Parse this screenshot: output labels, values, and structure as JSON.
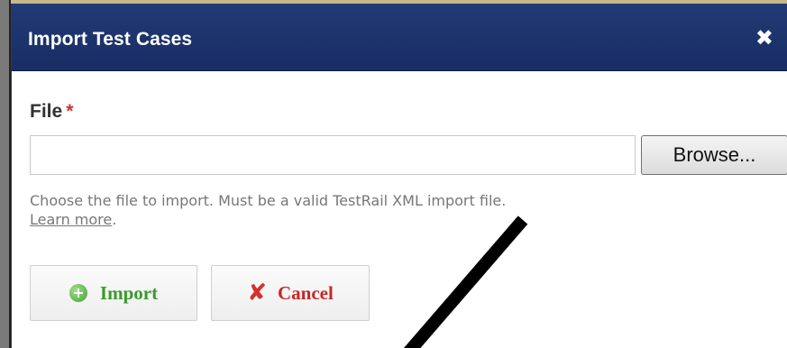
{
  "dialog": {
    "title": "Import Test Cases",
    "close_glyph": "✖"
  },
  "file_field": {
    "label": "File",
    "required_mark": "*",
    "value": "",
    "browse_label": "Browse..."
  },
  "hint": {
    "text": "Choose the file to import. Must be a valid TestRail XML import file.",
    "link_text": "Learn more",
    "trailing": "."
  },
  "actions": {
    "import_label": "Import",
    "cancel_label": "Cancel"
  },
  "icons": {
    "import": "plus-circle-icon",
    "cancel": "x-icon",
    "close": "close-icon"
  },
  "colors": {
    "titlebar": "#1e3570",
    "import_text": "#3a9a2a",
    "cancel_text": "#c62828",
    "required": "#cc3333",
    "annotation": "#000000"
  }
}
